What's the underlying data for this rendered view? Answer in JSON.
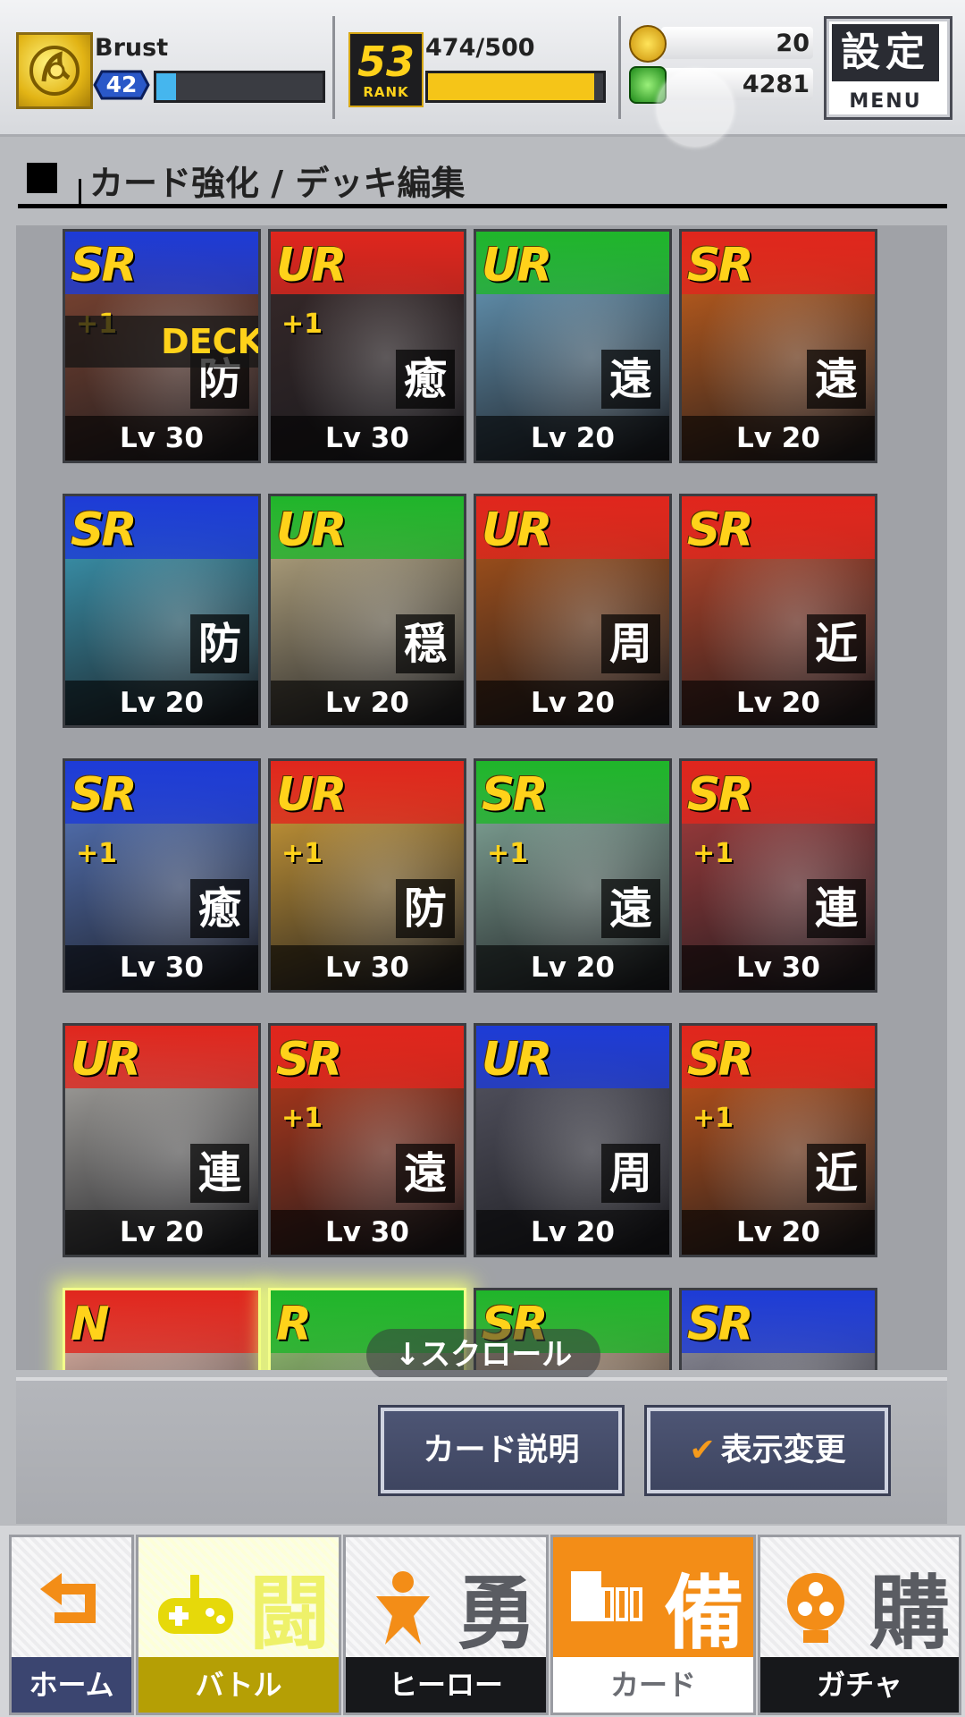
{
  "header": {
    "player_name": "Brust",
    "player_level": "42",
    "exp_fraction": 0.12,
    "rank_number": "53",
    "rank_label": "RANK",
    "stamina": "474/500",
    "stamina_fraction": 0.948,
    "coins": "20",
    "gems": "4281",
    "menu_kanji": "設定",
    "menu_label": "MENU"
  },
  "section_title": "カード強化 / デッキ編集",
  "deck_label": "DECK",
  "cards": [
    {
      "rarity": "SR",
      "plus": "+1",
      "role": "防",
      "level": "Lv 30",
      "band": "#1d3bd6",
      "art": "#8a4a34",
      "deck": true
    },
    {
      "rarity": "UR",
      "plus": "+1",
      "role": "癒",
      "level": "Lv 30",
      "band": "#e0261d",
      "art": "#3a2a2a",
      "deck": false
    },
    {
      "rarity": "UR",
      "plus": "",
      "role": "遠",
      "level": "Lv 20",
      "band": "#1fb52a",
      "art": "#6ea6c8",
      "deck": false
    },
    {
      "rarity": "SR",
      "plus": "",
      "role": "遠",
      "level": "Lv 20",
      "band": "#e0261d",
      "art": "#d4661d",
      "deck": false
    },
    {
      "rarity": "SR",
      "plus": "",
      "role": "防",
      "level": "Lv 20",
      "band": "#1d3bd6",
      "art": "#3fa7c4",
      "deck": false
    },
    {
      "rarity": "UR",
      "plus": "",
      "role": "穏",
      "level": "Lv 20",
      "band": "#1fb52a",
      "art": "#c9b88d",
      "deck": false
    },
    {
      "rarity": "UR",
      "plus": "",
      "role": "周",
      "level": "Lv 20",
      "band": "#e0261d",
      "art": "#b8591a",
      "deck": false
    },
    {
      "rarity": "SR",
      "plus": "",
      "role": "近",
      "level": "Lv 20",
      "band": "#e0261d",
      "art": "#c94a2a",
      "deck": false
    },
    {
      "rarity": "SR",
      "plus": "+1",
      "role": "癒",
      "level": "Lv 30",
      "band": "#1d3bd6",
      "art": "#5b7ec9",
      "deck": false
    },
    {
      "rarity": "UR",
      "plus": "+1",
      "role": "防",
      "level": "Lv 30",
      "band": "#e0261d",
      "art": "#e0a93a",
      "deck": false
    },
    {
      "rarity": "SR",
      "plus": "+1",
      "role": "遠",
      "level": "Lv 20",
      "band": "#1fb52a",
      "art": "#8fb8a8",
      "deck": false
    },
    {
      "rarity": "SR",
      "plus": "+1",
      "role": "連",
      "level": "Lv 30",
      "band": "#e0261d",
      "art": "#b04040",
      "deck": false
    },
    {
      "rarity": "UR",
      "plus": "",
      "role": "連",
      "level": "Lv 20",
      "band": "#e0261d",
      "art": "#b7b5b0",
      "deck": false
    },
    {
      "rarity": "SR",
      "plus": "+1",
      "role": "遠",
      "level": "Lv 30",
      "band": "#e0261d",
      "art": "#c43c1a",
      "deck": false
    },
    {
      "rarity": "UR",
      "plus": "",
      "role": "周",
      "level": "Lv 20",
      "band": "#1d3bd6",
      "art": "#5a5a68",
      "deck": false
    },
    {
      "rarity": "SR",
      "plus": "+1",
      "role": "近",
      "level": "Lv 20",
      "band": "#e0261d",
      "art": "#d05a1a",
      "deck": false
    },
    {
      "rarity": "N",
      "plus": "",
      "role": "",
      "level": "",
      "band": "#e0261d",
      "art": "#f0c0b0",
      "deck": false,
      "glow": true
    },
    {
      "rarity": "R",
      "plus": "",
      "role": "",
      "level": "",
      "band": "#1fb52a",
      "art": "#9fd07a",
      "deck": false,
      "glow": true
    },
    {
      "rarity": "SR",
      "plus": "",
      "role": "",
      "level": "",
      "band": "#1fb52a",
      "art": "#d0b090",
      "deck": false
    },
    {
      "rarity": "SR",
      "plus": "",
      "role": "",
      "level": "",
      "band": "#1d3bd6",
      "art": "#9a9aa8",
      "deck": false
    }
  ],
  "scroll_hint": "↓スクロール",
  "actions": {
    "card_description": "カード説明",
    "display_change": "表示変更"
  },
  "nav": [
    {
      "id": "home",
      "label": "ホーム",
      "kanji": "",
      "icon": "back-arrow-icon"
    },
    {
      "id": "battle",
      "label": "バトル",
      "kanji": "闘",
      "icon": "gamepad-icon"
    },
    {
      "id": "hero",
      "label": "ヒーロー",
      "kanji": "勇",
      "icon": "hero-icon"
    },
    {
      "id": "card",
      "label": "カード",
      "kanji": "備",
      "icon": "cards-icon"
    },
    {
      "id": "gacha",
      "label": "ガチャ",
      "kanji": "購",
      "icon": "gacha-icon"
    }
  ],
  "colors": {
    "accent_orange": "#f38d17",
    "gold": "#ffd21a",
    "exp_blue": "#45b6ee",
    "button_navy": "#4d5574"
  }
}
